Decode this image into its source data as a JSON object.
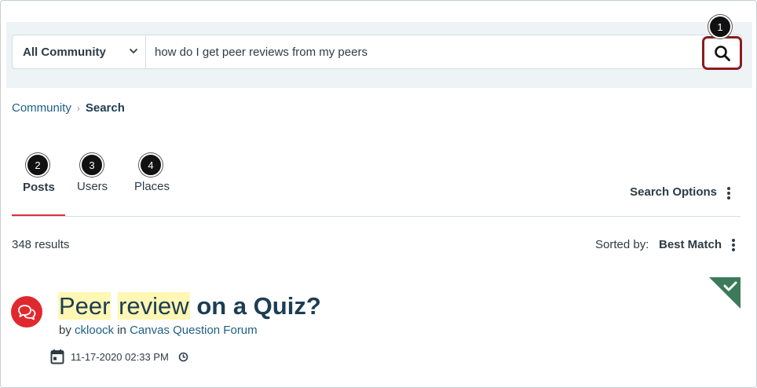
{
  "search": {
    "scope": "All Community",
    "query": "how do I get peer reviews from my peers",
    "placeholder": ""
  },
  "breadcrumb": {
    "home": "Community",
    "current": "Search"
  },
  "tabs": [
    {
      "label": "Posts",
      "active": true
    },
    {
      "label": "Users",
      "active": false
    },
    {
      "label": "Places",
      "active": false
    }
  ],
  "callouts": [
    "1",
    "2",
    "3",
    "4"
  ],
  "search_options_label": "Search Options",
  "results": {
    "count": "348 results",
    "sorted_label": "Sorted by:",
    "sorted_value": "Best Match"
  },
  "post": {
    "title_hl1": "Peer",
    "title_hl2": "review",
    "title_rest": "on a Quiz?",
    "by": "by",
    "author": "ckloock",
    "in": "in",
    "forum": "Canvas Question Forum",
    "date": "11-17-2020 02:33 PM"
  },
  "colors": {
    "accent_red": "#e0282f",
    "focus_border": "#8b1b1e",
    "link": "#1d5f85",
    "solved": "#3d7a5a",
    "highlight": "#fff7b3"
  },
  "icons": [
    "chevron-down-icon",
    "search-icon",
    "kebab-icon",
    "conversation-icon",
    "calendar-icon",
    "clock-icon",
    "checkmark-icon"
  ]
}
